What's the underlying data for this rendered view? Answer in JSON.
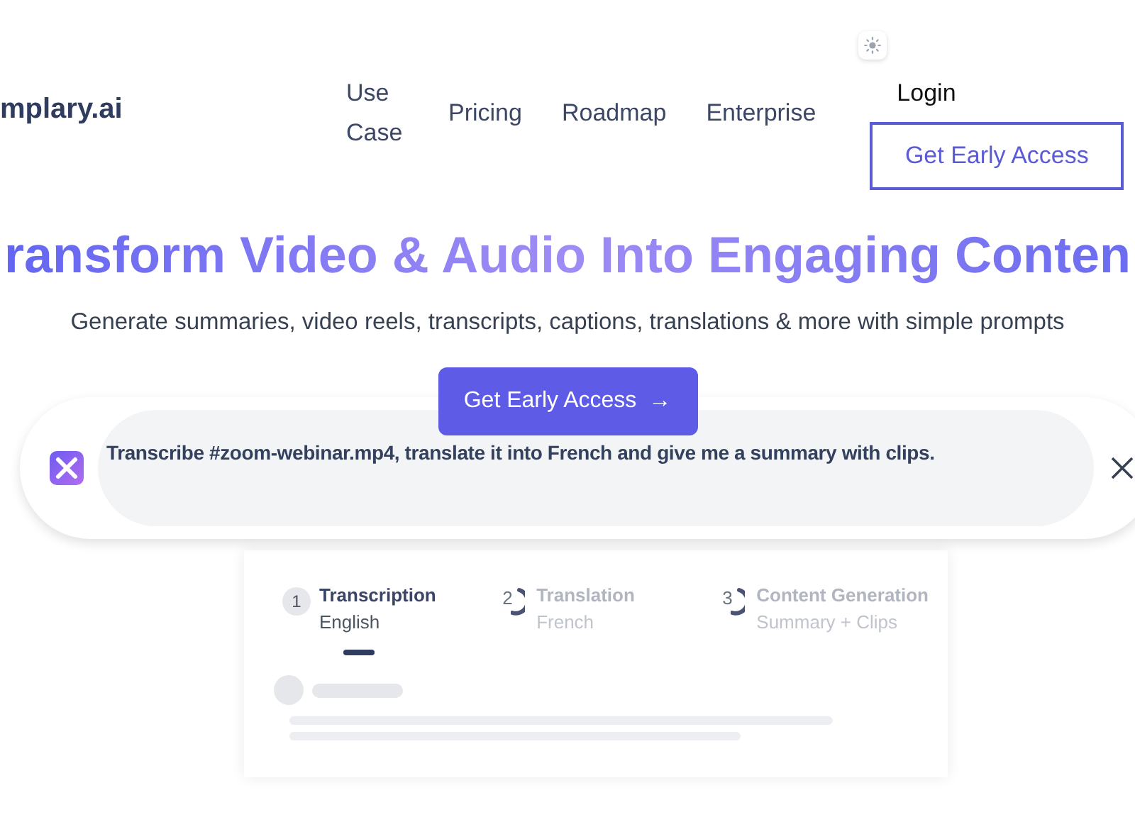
{
  "header": {
    "logo": "mplary.ai",
    "nav": [
      "Use\nCase",
      "Pricing",
      "Roadmap",
      "Enterprise"
    ],
    "login": "Login",
    "cta": "Get Early Access"
  },
  "hero": {
    "title": "ransform Video & Audio Into Engaging Conten",
    "subtitle": "Generate summaries, video reels, transcripts, captions, translations & more with simple prompts",
    "cta": "Get Early Access",
    "cta_arrow": "→"
  },
  "prompt": {
    "text": "Transcribe #zoom-webinar.mp4, translate it into French and give me a summary with clips."
  },
  "steps": [
    {
      "number": "1",
      "title": "Transcription",
      "subtitle": "English",
      "selected": true
    },
    {
      "number": "2",
      "title": "Translation",
      "subtitle": "French",
      "selected": false
    },
    {
      "number": "3",
      "title": "Content Generation",
      "subtitle": "Summary + Clips",
      "selected": false
    }
  ]
}
